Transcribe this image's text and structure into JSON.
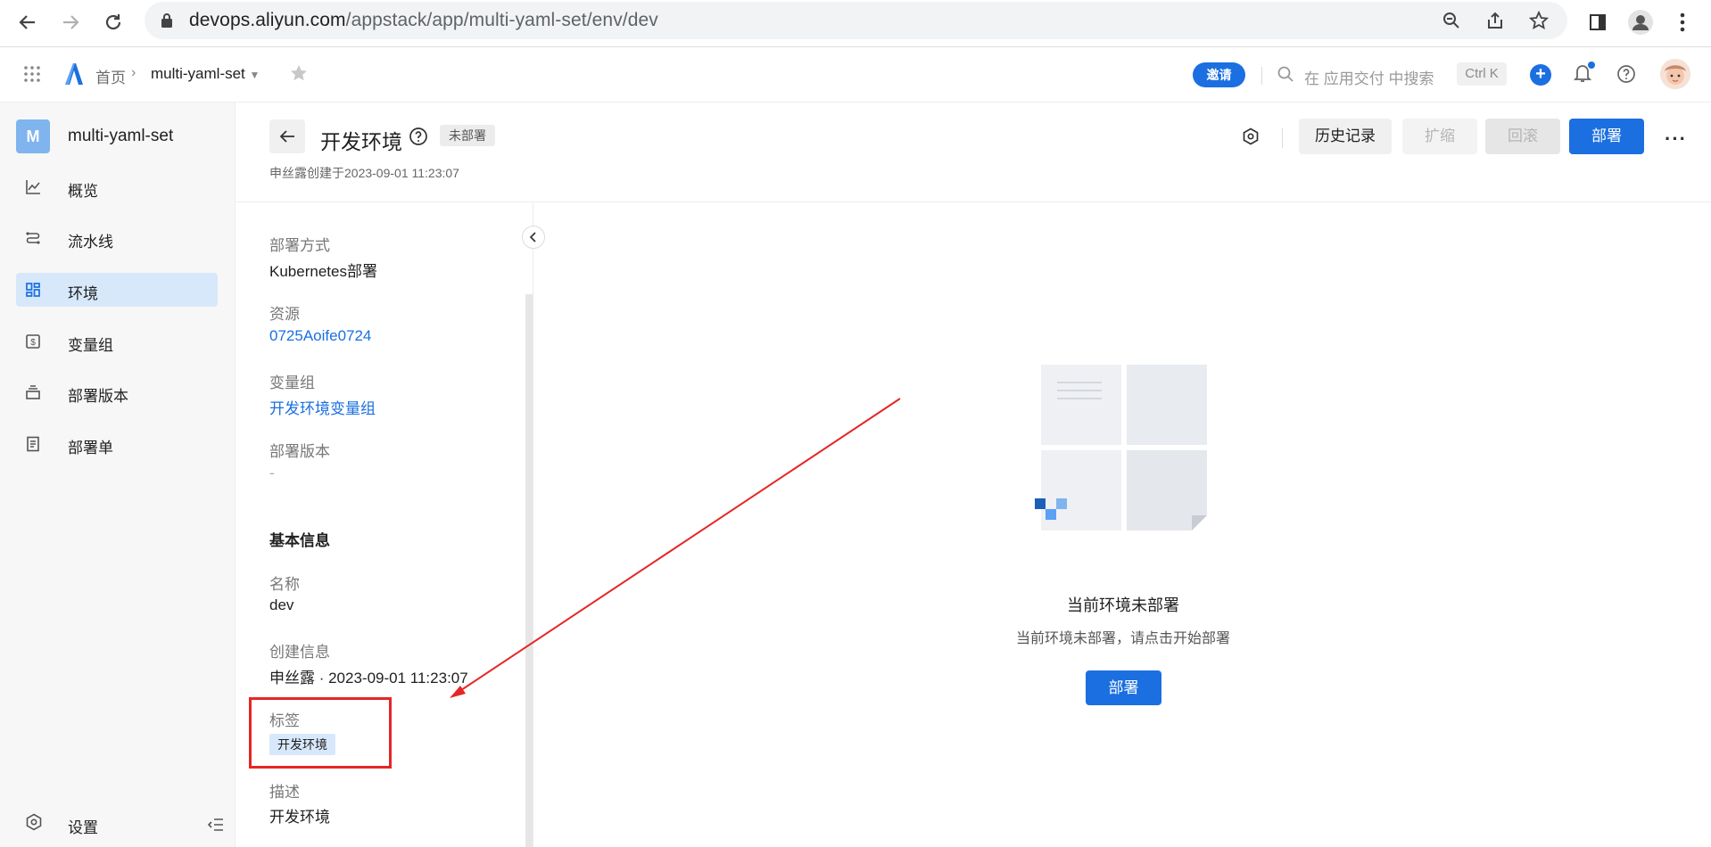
{
  "browser": {
    "url_host": "devops.aliyun.com",
    "url_path": "/appstack/app/multi-yaml-set/env/dev"
  },
  "header": {
    "breadcrumb_home": "首页",
    "breadcrumb_app": "multi-yaml-set",
    "invite_label": "邀请",
    "search_placeholder": "在 应用交付 中搜索",
    "shortcut": "Ctrl K",
    "plus": "+"
  },
  "sidebar": {
    "badge": "M",
    "app_name": "multi-yaml-set",
    "items": [
      {
        "label": "概览",
        "icon": "chart-icon"
      },
      {
        "label": "流水线",
        "icon": "pipeline-icon"
      },
      {
        "label": "环境",
        "icon": "grid-icon",
        "active": true
      },
      {
        "label": "变量组",
        "icon": "variable-icon"
      },
      {
        "label": "部署版本",
        "icon": "version-icon"
      },
      {
        "label": "部署单",
        "icon": "document-icon"
      }
    ],
    "settings_label": "设置"
  },
  "page": {
    "title": "开发环境",
    "status": "未部署",
    "created": "申丝露创建于2023-09-01 11:23:07",
    "buttons": {
      "history": "历史记录",
      "scale": "扩缩",
      "rollback": "回滚",
      "deploy": "部署"
    }
  },
  "details": {
    "deploy_method_label": "部署方式",
    "deploy_method_value": "Kubernetes部署",
    "resource_label": "资源",
    "resource_value": "0725Aoife0724",
    "vargroup_label": "变量组",
    "vargroup_value": "开发环境变量组",
    "version_label": "部署版本",
    "version_value": "-",
    "basic_info_title": "基本信息",
    "name_label": "名称",
    "name_value": "dev",
    "create_label": "创建信息",
    "create_value": "申丝露 · 2023-09-01 11:23:07",
    "tags_label": "标签",
    "tag_value": "开发环境",
    "desc_label": "描述",
    "desc_value": "开发环境"
  },
  "empty_state": {
    "title": "当前环境未部署",
    "subtitle": "当前环境未部署，请点击开始部署",
    "button": "部署"
  },
  "colors": {
    "primary": "#1b6fe0",
    "active_bg": "#d7e8fb",
    "annotation": "#e52626"
  }
}
